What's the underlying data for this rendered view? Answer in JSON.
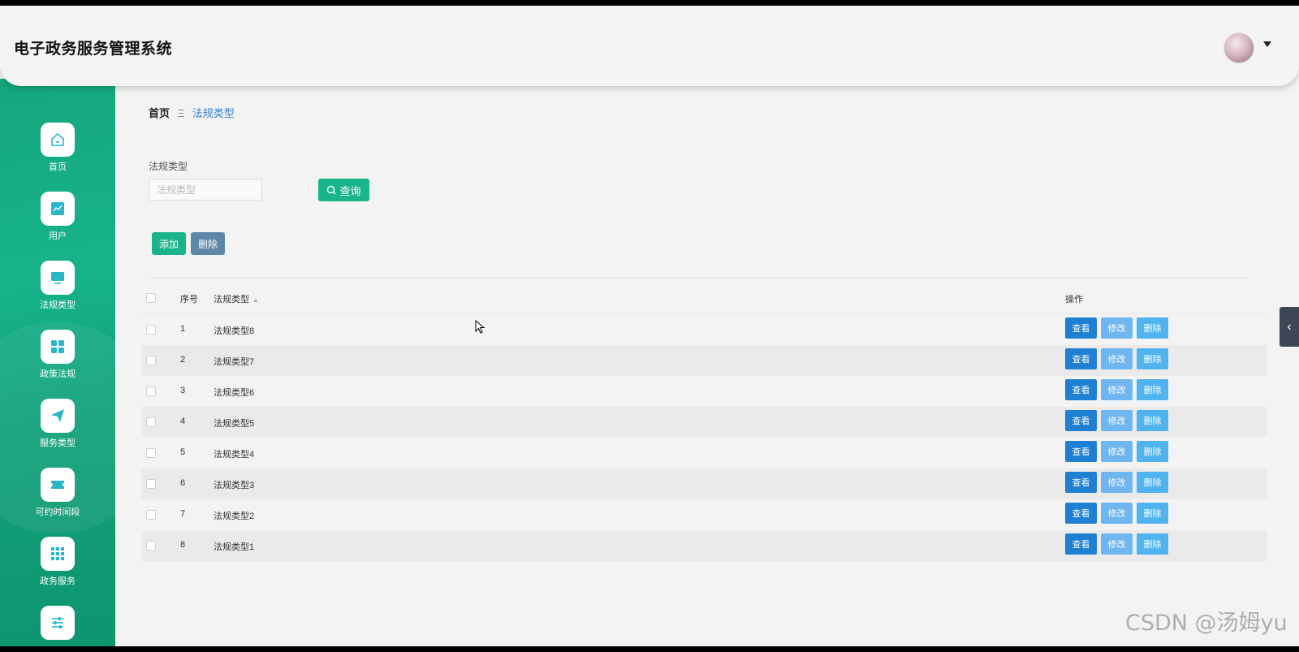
{
  "header": {
    "title": "电子政务服务管理系统"
  },
  "sidebar": {
    "items": [
      {
        "label": "首页",
        "icon": "home-icon"
      },
      {
        "label": "用户",
        "icon": "chart-icon"
      },
      {
        "label": "法规类型",
        "icon": "monitor-icon"
      },
      {
        "label": "政策法规",
        "icon": "grid-icon"
      },
      {
        "label": "服务类型",
        "icon": "send-icon"
      },
      {
        "label": "可约时间段",
        "icon": "ticket-icon"
      },
      {
        "label": "政务服务",
        "icon": "apps-icon"
      },
      {
        "label": "",
        "icon": "sliders-icon"
      }
    ]
  },
  "breadcrumb": {
    "home": "首页",
    "separator": "Ξ",
    "current": "法规类型"
  },
  "search": {
    "label": "法规类型",
    "placeholder": "法规类型",
    "value": "",
    "button_label": "查询"
  },
  "actions": {
    "add_label": "添加",
    "delete_label": "删除"
  },
  "table": {
    "columns": [
      "序号",
      "法规类型",
      "操作"
    ],
    "rows": [
      {
        "index": "1",
        "name": "法规类型8"
      },
      {
        "index": "2",
        "name": "法规类型7"
      },
      {
        "index": "3",
        "name": "法规类型6"
      },
      {
        "index": "4",
        "name": "法规类型5"
      },
      {
        "index": "5",
        "name": "法规类型4"
      },
      {
        "index": "6",
        "name": "法规类型3"
      },
      {
        "index": "7",
        "name": "法规类型2"
      },
      {
        "index": "8",
        "name": "法规类型1"
      }
    ],
    "row_actions": {
      "view": "查看",
      "edit": "修改",
      "delete": "删除"
    }
  },
  "watermark": "CSDN @汤姆yu",
  "colors": {
    "sidebar": "#15a77e",
    "primary": "#19b48a",
    "view": "#1e7fd3",
    "edit": "#6fb5ef",
    "delete": "#4fb3f0"
  }
}
